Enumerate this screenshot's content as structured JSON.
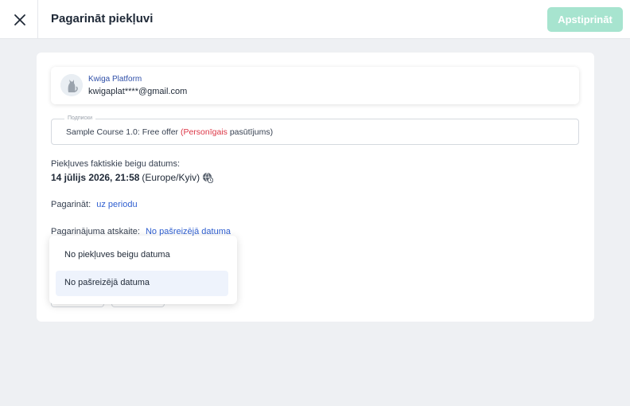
{
  "header": {
    "title": "Pagarināt piekļuvi",
    "confirm_label": "Apstiprināt",
    "close_icon": "close-icon"
  },
  "user": {
    "name": "Kwiga Platform",
    "email": "kwigaplat****@gmail.com",
    "avatar_icon": "cat-avatar"
  },
  "subscription": {
    "legend": "Подписки",
    "course": "Sample Course 1.0: Free offer",
    "type_personal": "(Personīgais",
    "type_rest": "pasūtījums)"
  },
  "access_end": {
    "label": "Piekļuves faktiskie beigu datums:",
    "date": "14 jūlijs 2026, 21:58",
    "timezone": "(Europe/Kyiv)",
    "tz_icon": "globe-clock-icon"
  },
  "extend": {
    "label": "Pagarināt:",
    "value": "uz periodu"
  },
  "reference": {
    "label": "Pagarinājuma atskaite:",
    "value": "No pašreizējā datuma"
  },
  "dropdown": {
    "options": [
      "No piekļuves beigu datuma",
      "No pašreizējā datuma"
    ],
    "selected_index": 1
  },
  "colors": {
    "accent_link": "#2f5fd0",
    "confirm_disabled": "#a7e4cf",
    "personal_red": "#dc3545"
  }
}
